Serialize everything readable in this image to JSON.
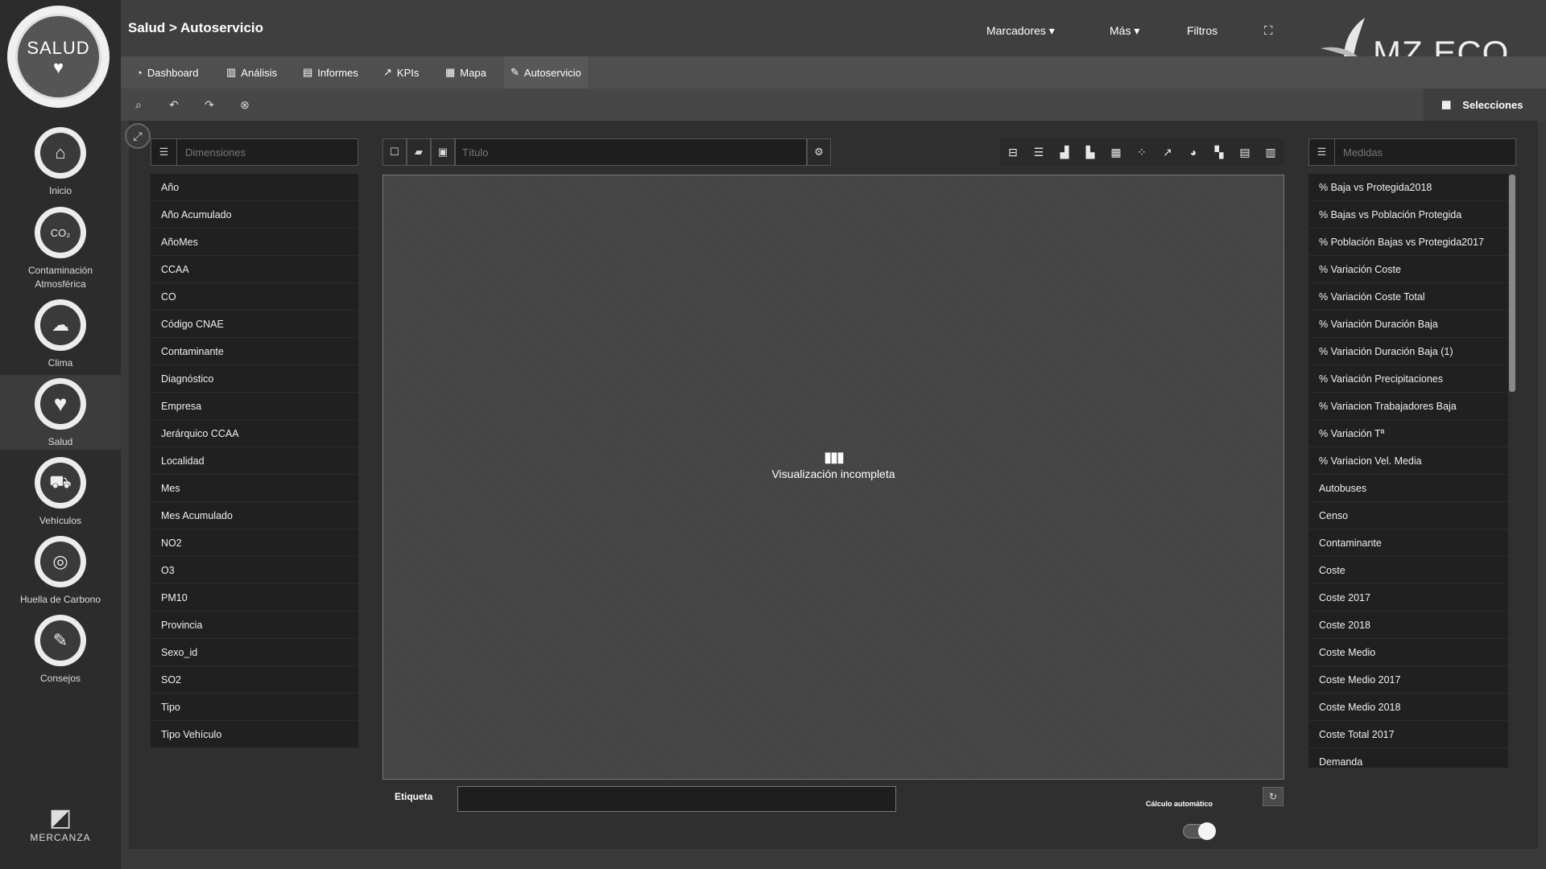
{
  "app": {
    "logo_text": "SALUD",
    "logo_heart": "♥",
    "breadcrumb": "Salud > Autoservicio",
    "brand_name": "MERCANZA",
    "partner_logo": "MZ ECO"
  },
  "top_menu": {
    "marcadores": "Marcadores ▾",
    "mas": "Más ▾",
    "filtros": "Filtros"
  },
  "sidebar": {
    "items": [
      {
        "label": "Inicio",
        "icon": "home-icon",
        "glyph": "⌂"
      },
      {
        "label": "Contaminación Atmosférica",
        "icon": "co2-cloud-icon",
        "glyph": "CO₂"
      },
      {
        "label": "Clima",
        "icon": "weather-icon",
        "glyph": "☁"
      },
      {
        "label": "Salud",
        "icon": "heart-icon",
        "glyph": "♥"
      },
      {
        "label": "Vehículos",
        "icon": "truck-icon",
        "glyph": "⛟"
      },
      {
        "label": "Huella de Carbono",
        "icon": "fingerprint-icon",
        "glyph": "◎"
      },
      {
        "label": "Consejos",
        "icon": "advice-icon",
        "glyph": "✎"
      }
    ]
  },
  "tabs": [
    {
      "label": "Dashboard",
      "icon": "dashboard-icon",
      "glyph": "◔"
    },
    {
      "label": "Análisis",
      "icon": "bar-chart-icon",
      "glyph": "▥"
    },
    {
      "label": "Informes",
      "icon": "report-icon",
      "glyph": "▤"
    },
    {
      "label": "KPIs",
      "icon": "kpi-line-icon",
      "glyph": "↗"
    },
    {
      "label": "Mapa",
      "icon": "map-icon",
      "glyph": "▦"
    },
    {
      "label": "Autoservicio",
      "icon": "edit-icon",
      "glyph": "✎"
    }
  ],
  "selecciones": "Selecciones",
  "dimensions": {
    "placeholder": "Dimensiones",
    "items": [
      "Año",
      "Año Acumulado",
      "AñoMes",
      "CCAA",
      "CO",
      "Código CNAE",
      "Contaminante",
      "Diagnóstico",
      "Empresa",
      "Jerárquico CCAA",
      "Localidad",
      "Mes",
      "Mes Acumulado",
      "NO2",
      "O3",
      "PM10",
      "Provincia",
      "Sexo_id",
      "SO2",
      "Tipo",
      "Tipo Vehículo"
    ]
  },
  "title_field": {
    "placeholder": "Título"
  },
  "canvas": {
    "message": "Visualización incompleta",
    "glyph": "▮▮▮"
  },
  "measures": {
    "placeholder": "Medidas",
    "items": [
      "% Baja vs Protegida2018",
      "% Bajas vs Población Protegida",
      "% Población Bajas vs Protegida2017",
      "% Variación Coste",
      "% Variación Coste Total",
      "% Variación Duración Baja",
      "% Variación Duración Baja (1)",
      "% Variación Precipitaciones",
      "% Variacion Trabajadores Baja",
      "% Variación Tª",
      "% Variacion Vel. Media",
      "Autobuses",
      "Censo",
      "Contaminante",
      "Coste",
      "Coste 2017",
      "Coste 2018",
      "Coste Medio",
      "Coste Medio 2017",
      "Coste Medio 2018",
      "Coste Total 2017",
      "Demanda"
    ]
  },
  "footer": {
    "etiqueta": "Etiqueta",
    "calculo": "Cálculo automático",
    "auto_calc_on": true
  }
}
